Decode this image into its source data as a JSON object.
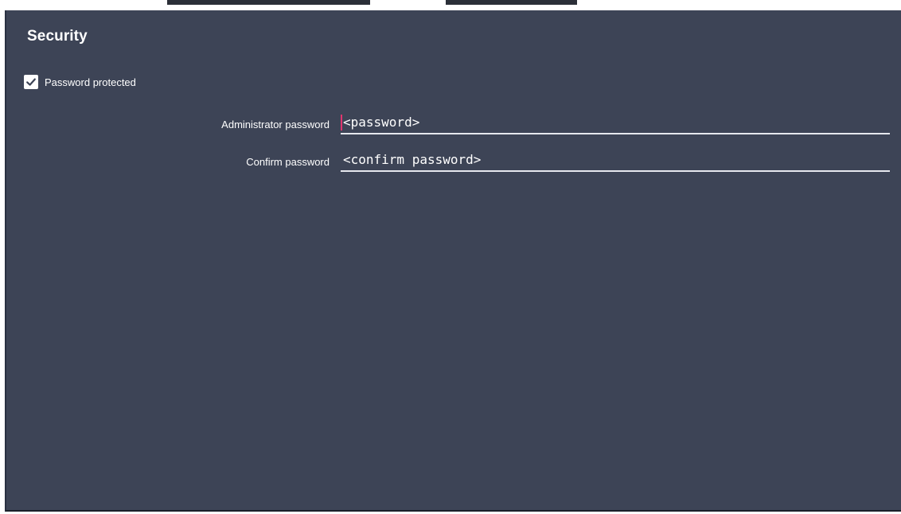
{
  "section": {
    "title": "Security"
  },
  "password_protected": {
    "label": "Password protected",
    "checked": true
  },
  "fields": {
    "admin_password": {
      "label": "Administrator password",
      "value": "<password>"
    },
    "confirm_password": {
      "label": "Confirm password",
      "value": "<confirm password>"
    }
  },
  "colors": {
    "panel_background": "#3d4456",
    "text": "#ffffff",
    "caret": "#e0356e",
    "field_underline": "#e6e8ee"
  }
}
